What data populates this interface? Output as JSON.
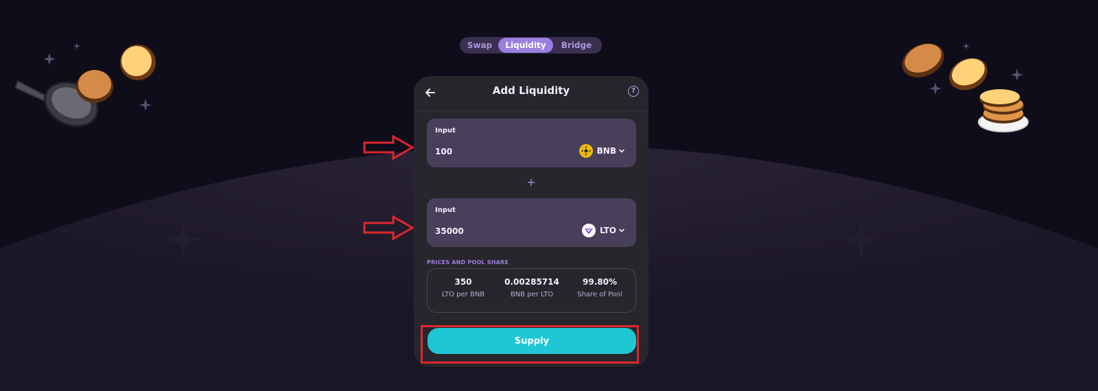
{
  "nav": {
    "tabs": [
      {
        "label": "Swap",
        "active": false
      },
      {
        "label": "Liquidity",
        "active": true
      },
      {
        "label": "Bridge",
        "active": false
      }
    ]
  },
  "card": {
    "title": "Add Liquidity",
    "back_icon": "arrow-left-icon",
    "help_icon": "question-circle-icon",
    "help_glyph": "?"
  },
  "input1": {
    "label": "Input",
    "value": "100",
    "token": "BNB",
    "token_icon": "bnb-coin-icon"
  },
  "plus": "+",
  "input2": {
    "label": "Input",
    "value": "35000",
    "token": "LTO",
    "token_icon": "lto-coin-icon"
  },
  "pool": {
    "section_label": "PRICES AND POOL SHARE",
    "items": [
      {
        "value": "350",
        "caption": "LTO per BNB"
      },
      {
        "value": "0.00285714",
        "caption": "BNB per LTO"
      },
      {
        "value": "99.80%",
        "caption": "Share of Pool"
      }
    ]
  },
  "supply": {
    "label": "Supply"
  },
  "colors": {
    "background": "#100d1a",
    "card": "#27262c",
    "input_panel": "#483f5a",
    "accent": "#1fc7d4",
    "active_tab": "#9a7fe0",
    "annotation_red": "#e0262e"
  }
}
